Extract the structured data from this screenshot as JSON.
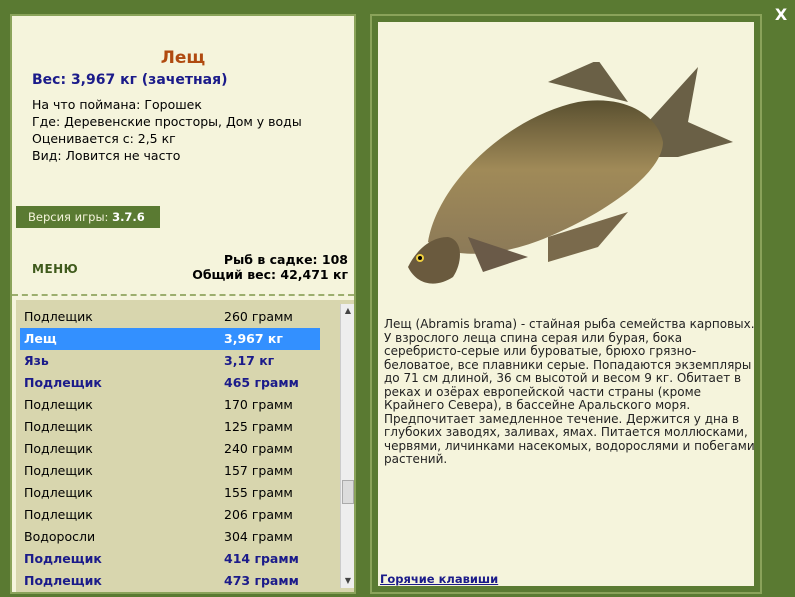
{
  "fish": {
    "name": "Лещ",
    "weight_line": "Вес: 3,967 кг (зачетная)",
    "caught_on": "На что поймана: Горошек",
    "location": "Где: Деревенские просторы, Дом у воды",
    "value": "Оценивается с: 2,5 кг",
    "rarity": "Вид: Ловится не часто"
  },
  "version": {
    "label": "Версия игры:",
    "value": "3.7.6"
  },
  "menu_label": "МЕНЮ",
  "totals": {
    "fish_in_net": "Рыб в садке: 108",
    "total_weight": "Общий вес: 42,471 кг"
  },
  "catch_list": [
    {
      "name": "Подлещик",
      "weight": "260 грамм",
      "style": "normal"
    },
    {
      "name": "Лещ",
      "weight": "3,967 кг",
      "style": "selected"
    },
    {
      "name": "Язь",
      "weight": "3,17 кг",
      "style": "highlight"
    },
    {
      "name": "Подлещик",
      "weight": "465 грамм",
      "style": "highlight"
    },
    {
      "name": "Подлещик",
      "weight": "170 грамм",
      "style": "normal"
    },
    {
      "name": "Подлещик",
      "weight": "125 грамм",
      "style": "normal"
    },
    {
      "name": "Подлещик",
      "weight": "240 грамм",
      "style": "normal"
    },
    {
      "name": "Подлещик",
      "weight": "157 грамм",
      "style": "normal"
    },
    {
      "name": "Подлещик",
      "weight": "155 грамм",
      "style": "normal"
    },
    {
      "name": "Подлещик",
      "weight": "206 грамм",
      "style": "normal"
    },
    {
      "name": "Водоросли",
      "weight": "304 грамм",
      "style": "normal"
    },
    {
      "name": "Подлещик",
      "weight": "414 грамм",
      "style": "highlight"
    },
    {
      "name": "Подлещик",
      "weight": "473 грамм",
      "style": "highlight"
    }
  ],
  "description": "Лещ (Abramis brama) - стайная рыба семейства карповых. У взрослого леща спина серая или бурая, бока серебристо-серые или буроватые, брюхо грязно-беловатое, все плавники серые. Попадаются экземпляры до 71 см длиной, 36 см высотой и весом 9 кг. Обитает в реках и озёрах европейской части страны (кроме Крайнего Севера), в бассейне Аральского моря. Предпочитает замедленное течение. Держится у дна в глубоких заводях, заливах, ямах. Питается моллюсками, червями, личинками насекомых, водорослями и побегами растений.",
  "hotkeys_label": "Горячие клавиши",
  "close_label": "X",
  "colors": {
    "background": "#5a7a32",
    "panel": "#f5f4dc",
    "title": "#b04a10",
    "highlight": "#1b1b8a",
    "selected": "#3390ff"
  }
}
